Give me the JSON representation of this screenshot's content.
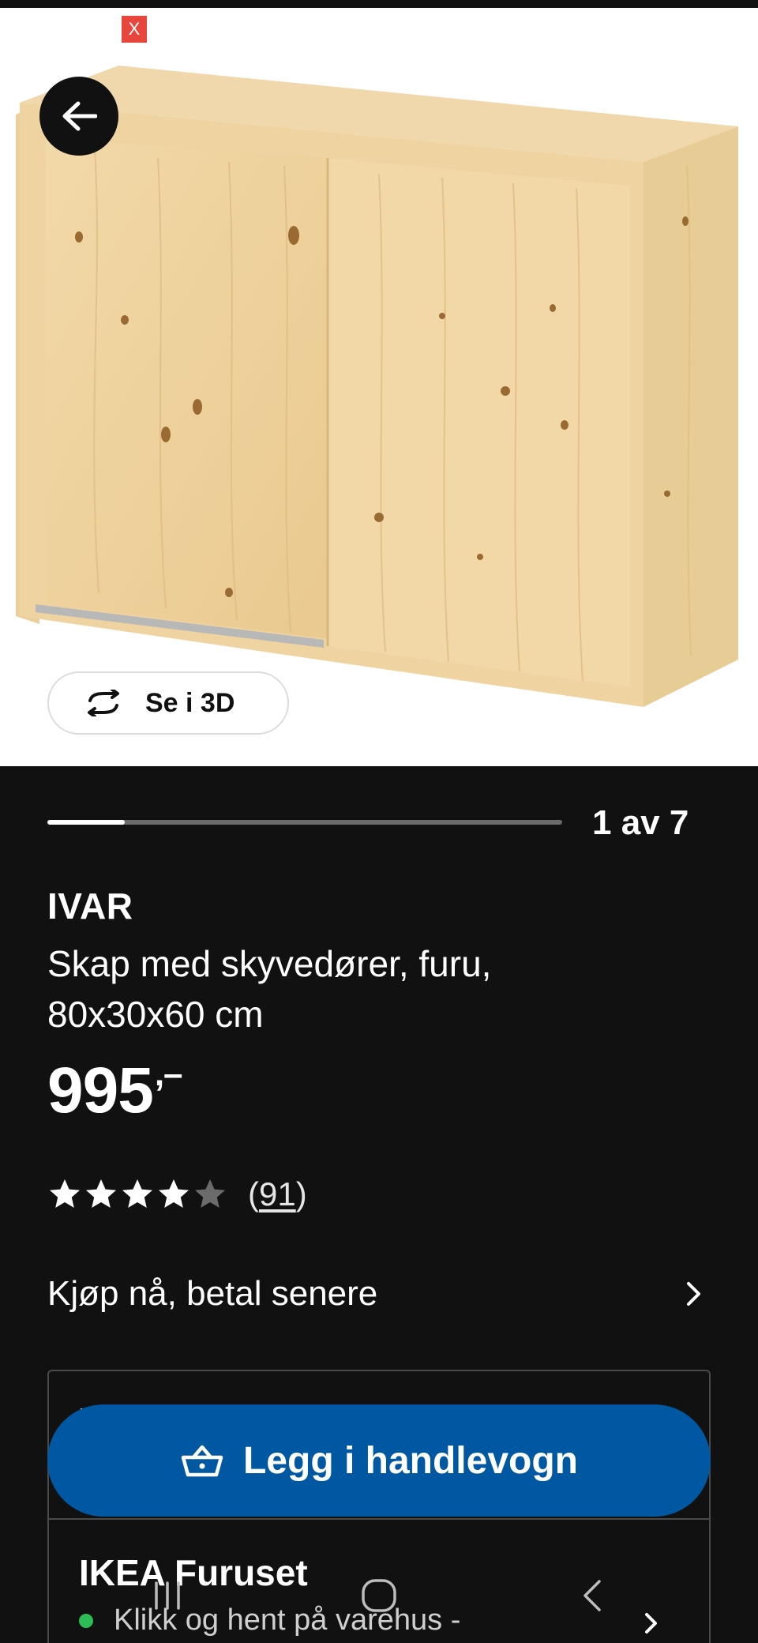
{
  "ad": {
    "close_label": "X"
  },
  "product_view": {
    "view_3d_label": "Se i 3D"
  },
  "gallery": {
    "current": 1,
    "total": 7,
    "counter_text": "1 av 7",
    "progress_fraction": 0.15
  },
  "product": {
    "brand": "IVAR",
    "description": "Skap med skyvedører, furu, 80x30x60 cm",
    "price": "995",
    "price_suffix": ",–",
    "rating": 4,
    "rating_max": 5,
    "review_count_text": "91",
    "review_open": "(",
    "review_close": ")"
  },
  "financing": {
    "label": "Kjøp nå, betal senere"
  },
  "cart": {
    "button_label": "Legg i handlevogn"
  },
  "store": {
    "name": "IKEA Furuset",
    "availability": "Klikk og hent på varehus -"
  },
  "colors": {
    "accent": "#0058a3",
    "background": "#111111",
    "available": "#2dbd57",
    "ad_close": "#e8453c"
  },
  "icons": [
    "back-arrow-icon",
    "rotate-3d-icon",
    "star-icon",
    "chevron-right-icon",
    "shopping-basket-icon",
    "recents-icon",
    "home-icon",
    "back-icon"
  ]
}
